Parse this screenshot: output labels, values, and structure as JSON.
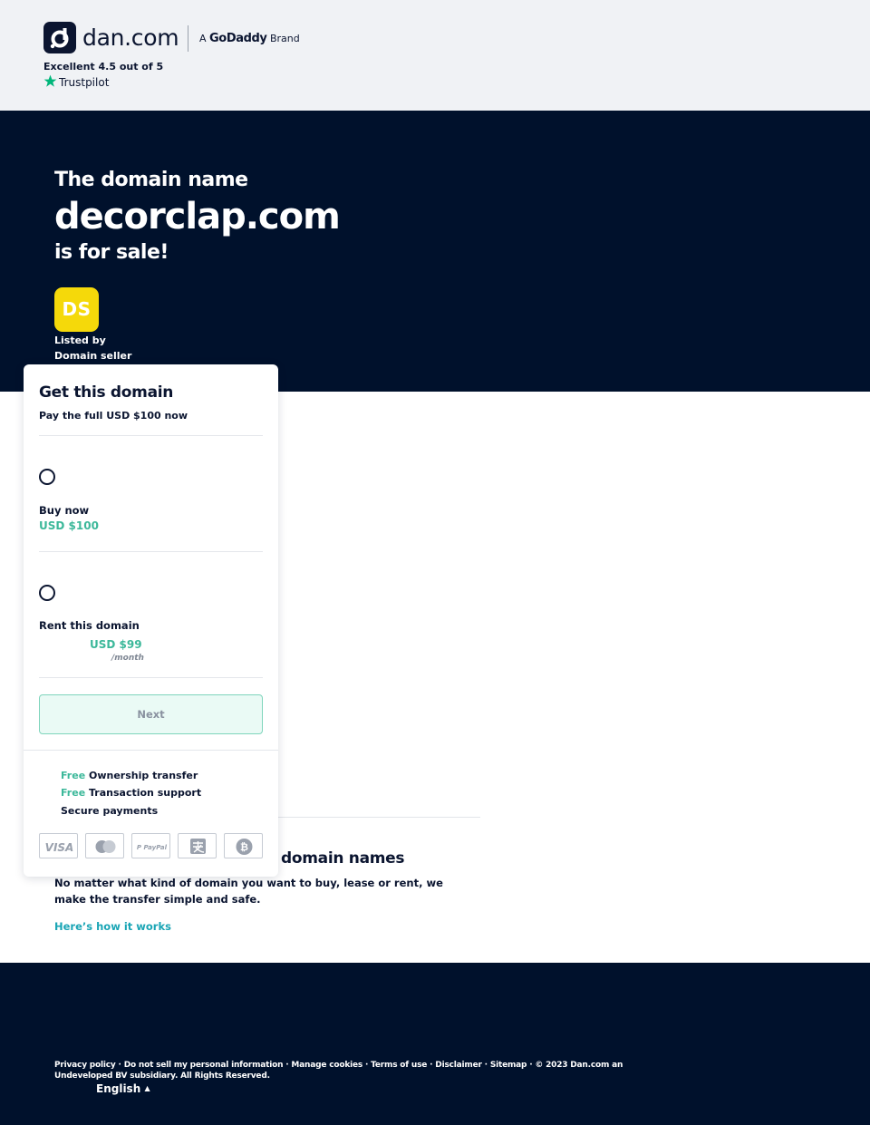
{
  "header": {
    "logo_text": "dan.com",
    "brand_prefix": "A",
    "brand_name": "GoDaddy",
    "brand_suffix": "Brand",
    "rating_text": "Excellent 4.5 out of 5",
    "trustpilot_label": "Trustpilot"
  },
  "hero": {
    "intro": "The domain name",
    "domain": "decorclap.com",
    "sale": "is for sale!",
    "seller_initials": "DS",
    "listed_by": "Listed by",
    "seller_name": "Domain seller"
  },
  "card": {
    "title": "Get this domain",
    "subtitle": "Pay the full USD $100 now",
    "option_buy": {
      "label": "Buy now",
      "price": "USD $100"
    },
    "option_rent": {
      "label": "Rent this domain",
      "price": "USD $99",
      "period": "/month"
    },
    "next_label": "Next",
    "perks": [
      {
        "free": "Free",
        "text": "Ownership transfer"
      },
      {
        "free": "Free",
        "text": "Transaction support"
      },
      {
        "free": "",
        "text": "Secure payments"
      }
    ],
    "payment_icons": [
      "visa-icon",
      "mastercard-icon",
      "paypal-icon",
      "alipay-icon",
      "bitcoin-icon"
    ]
  },
  "section": {
    "heading": "domain names",
    "text": "No matter what kind of domain you want to buy, lease or rent, we make the transfer simple and safe.",
    "link": "Here’s how it works"
  },
  "footer": {
    "links": [
      "Privacy policy",
      "Do not sell my personal information",
      "Manage cookies",
      "Terms of use",
      "Disclaimer",
      "Sitemap"
    ],
    "copyright": "© 2023 Dan.com an Undeveloped BV subsidiary. All Rights Reserved.",
    "language": "English"
  },
  "colors": {
    "navy": "#00112c",
    "accent_green": "#3cb89a",
    "link_teal": "#1aa5b5",
    "seller_yellow": "#f5d90a"
  }
}
